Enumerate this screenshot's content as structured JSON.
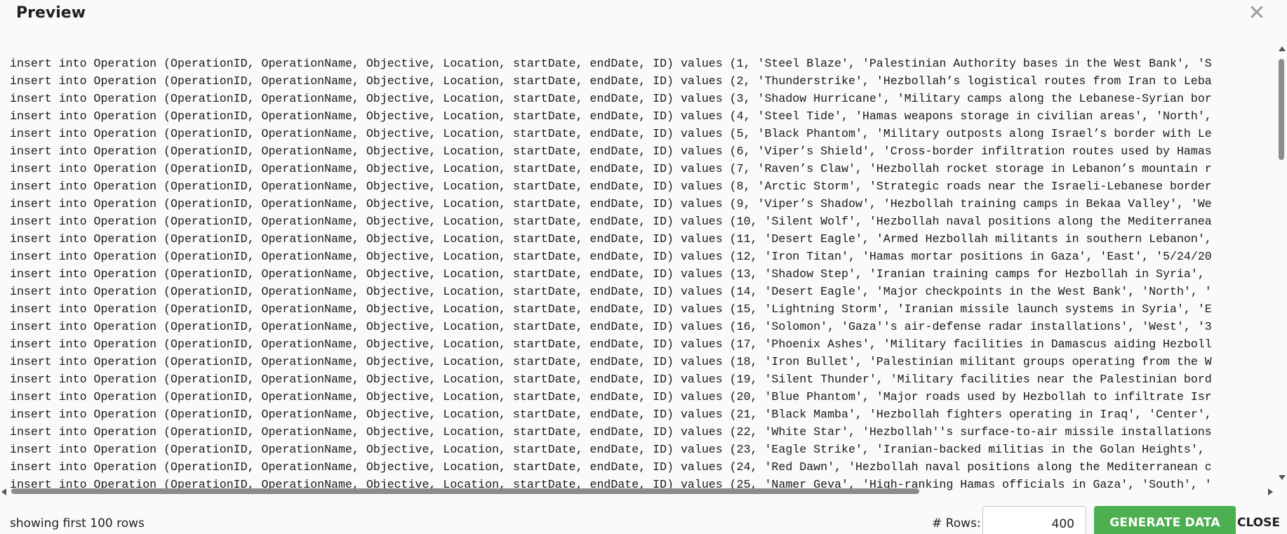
{
  "dialog": {
    "title": "Preview",
    "close_icon": "close-icon"
  },
  "preview": {
    "lines": [
      "insert into Operation (OperationID, OperationName, Objective, Location, startDate, endDate, ID) values (1, 'Steel Blaze', 'Palestinian Authority bases in the West Bank', 'S",
      "insert into Operation (OperationID, OperationName, Objective, Location, startDate, endDate, ID) values (2, 'Thunderstrike', 'Hezbollah’s logistical routes from Iran to Leba",
      "insert into Operation (OperationID, OperationName, Objective, Location, startDate, endDate, ID) values (3, 'Shadow Hurricane', 'Military camps along the Lebanese-Syrian bor",
      "insert into Operation (OperationID, OperationName, Objective, Location, startDate, endDate, ID) values (4, 'Steel Tide', 'Hamas weapons storage in civilian areas', 'North',",
      "insert into Operation (OperationID, OperationName, Objective, Location, startDate, endDate, ID) values (5, 'Black Phantom', 'Military outposts along Israel’s border with Le",
      "insert into Operation (OperationID, OperationName, Objective, Location, startDate, endDate, ID) values (6, 'Viper’s Shield', 'Cross-border infiltration routes used by Hamas",
      "insert into Operation (OperationID, OperationName, Objective, Location, startDate, endDate, ID) values (7, 'Raven’s Claw', 'Hezbollah rocket storage in Lebanon’s mountain r",
      "insert into Operation (OperationID, OperationName, Objective, Location, startDate, endDate, ID) values (8, 'Arctic Storm', 'Strategic roads near the Israeli-Lebanese border",
      "insert into Operation (OperationID, OperationName, Objective, Location, startDate, endDate, ID) values (9, 'Viper’s Shadow', 'Hezbollah training camps in Bekaa Valley', 'We",
      "insert into Operation (OperationID, OperationName, Objective, Location, startDate, endDate, ID) values (10, 'Silent Wolf', 'Hezbollah naval positions along the Mediterranea",
      "insert into Operation (OperationID, OperationName, Objective, Location, startDate, endDate, ID) values (11, 'Desert Eagle', 'Armed Hezbollah militants in southern Lebanon',",
      "insert into Operation (OperationID, OperationName, Objective, Location, startDate, endDate, ID) values (12, 'Iron Titan', 'Hamas mortar positions in Gaza', 'East', '5/24/20",
      "insert into Operation (OperationID, OperationName, Objective, Location, startDate, endDate, ID) values (13, 'Shadow Step', 'Iranian training camps for Hezbollah in Syria',",
      "insert into Operation (OperationID, OperationName, Objective, Location, startDate, endDate, ID) values (14, 'Desert Eagle', 'Major checkpoints in the West Bank', 'North', '",
      "insert into Operation (OperationID, OperationName, Objective, Location, startDate, endDate, ID) values (15, 'Lightning Storm', 'Iranian missile launch systems in Syria', 'E",
      "insert into Operation (OperationID, OperationName, Objective, Location, startDate, endDate, ID) values (16, 'Solomon', 'Gaza''s air-defense radar installations', 'West', '3",
      "insert into Operation (OperationID, OperationName, Objective, Location, startDate, endDate, ID) values (17, 'Phoenix Ashes', 'Military facilities in Damascus aiding Hezboll",
      "insert into Operation (OperationID, OperationName, Objective, Location, startDate, endDate, ID) values (18, 'Iron Bullet', 'Palestinian militant groups operating from the W",
      "insert into Operation (OperationID, OperationName, Objective, Location, startDate, endDate, ID) values (19, 'Silent Thunder', 'Military facilities near the Palestinian bord",
      "insert into Operation (OperationID, OperationName, Objective, Location, startDate, endDate, ID) values (20, 'Blue Phantom', 'Major roads used by Hezbollah to infiltrate Isr",
      "insert into Operation (OperationID, OperationName, Objective, Location, startDate, endDate, ID) values (21, 'Black Mamba', 'Hezbollah fighters operating in Iraq', 'Center',",
      "insert into Operation (OperationID, OperationName, Objective, Location, startDate, endDate, ID) values (22, 'White Star', 'Hezbollah''s surface-to-air missile installations",
      "insert into Operation (OperationID, OperationName, Objective, Location, startDate, endDate, ID) values (23, 'Eagle Strike', 'Iranian-backed militias in the Golan Heights',",
      "insert into Operation (OperationID, OperationName, Objective, Location, startDate, endDate, ID) values (24, 'Red Dawn', 'Hezbollah naval positions along the Mediterranean c",
      "insert into Operation (OperationID, OperationName, Objective, Location, startDate, endDate, ID) values (25, 'Namer Geva', 'High-ranking Hamas officials in Gaza', 'South', '"
    ]
  },
  "footer": {
    "status": "showing first 100 rows",
    "rows_label": "# Rows:",
    "rows_value": "400",
    "generate_label": "GENERATE DATA",
    "close_label": "CLOSE"
  },
  "colors": {
    "accent": "#4caf50",
    "background": "#fafafa"
  }
}
